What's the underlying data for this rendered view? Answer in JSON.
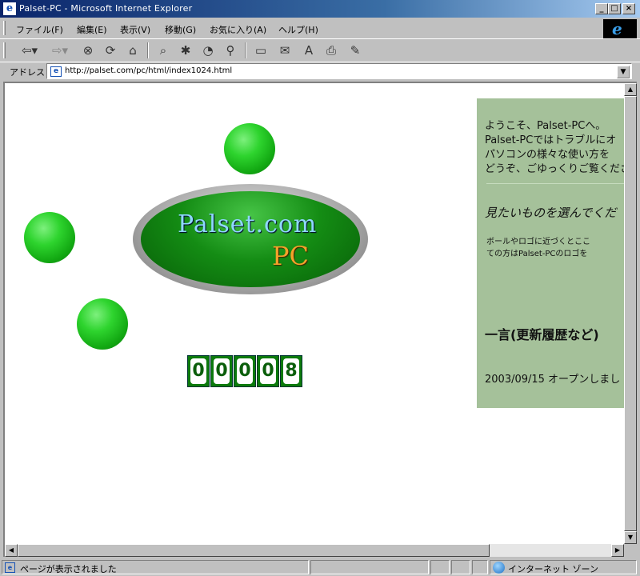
{
  "window": {
    "title": "Palset-PC - Microsoft Internet Explorer",
    "minimize": "_",
    "maximize": "□",
    "close": "×"
  },
  "menu": {
    "items": [
      "ファイル(F)",
      "編集(E)",
      "表示(V)",
      "移動(G)",
      "お気に入り(A)",
      "ヘルプ(H)"
    ],
    "brand_glyph": "e"
  },
  "toolbar": {
    "buttons": [
      {
        "name": "back-icon",
        "glyph": "⇦▾"
      },
      {
        "name": "forward-icon",
        "glyph": "⇨▾"
      },
      {
        "name": "stop-icon",
        "glyph": "⊗"
      },
      {
        "name": "refresh-icon",
        "glyph": "⟳"
      },
      {
        "name": "home-icon",
        "glyph": "⌂"
      },
      {
        "name": "search-icon",
        "glyph": "⌕"
      },
      {
        "name": "favorites-icon",
        "glyph": "✱"
      },
      {
        "name": "history-icon",
        "glyph": "◔"
      },
      {
        "name": "channels-icon",
        "glyph": "⚲"
      },
      {
        "name": "fullscreen-icon",
        "glyph": "▭"
      },
      {
        "name": "mail-icon",
        "glyph": "✉"
      },
      {
        "name": "font-icon",
        "glyph": "A"
      },
      {
        "name": "print-icon",
        "glyph": "⎙"
      },
      {
        "name": "edit-icon",
        "glyph": "✎"
      }
    ]
  },
  "address": {
    "label": "アドレス",
    "url": "http://palset.com/pc/html/index1024.html",
    "dropdown": "▼"
  },
  "page": {
    "logo": {
      "line1": "Palset.com",
      "line2": "PC"
    },
    "counter": [
      "0",
      "0",
      "0",
      "0",
      "8"
    ],
    "side": {
      "welcome": [
        "ようこそ、Palset-PCへ。",
        "Palset-PCではトラブルにオ",
        "パソコンの様々な使い方を",
        "どうぞ、ごゆっくりご覧くださ"
      ],
      "choose": "見たいものを選んでくだ",
      "hint": [
        "ボールやロゴに近づくとここ",
        "ての方はPalset-PCのロゴを"
      ],
      "history_title": "一言(更新履歴など)",
      "history_entry": "2003/09/15 オープンしまし"
    }
  },
  "scroll": {
    "up": "▲",
    "down": "▼",
    "left": "◀",
    "right": "▶"
  },
  "status": {
    "text": "ページが表示されました",
    "page_glyph": "e",
    "zone": "インターネット ゾーン"
  },
  "colors": {
    "title_gradient_start": "#0a246a",
    "chrome": "#c0c0c0",
    "side_panel": "#a5c19a",
    "ball_green": "#2ed42e"
  }
}
